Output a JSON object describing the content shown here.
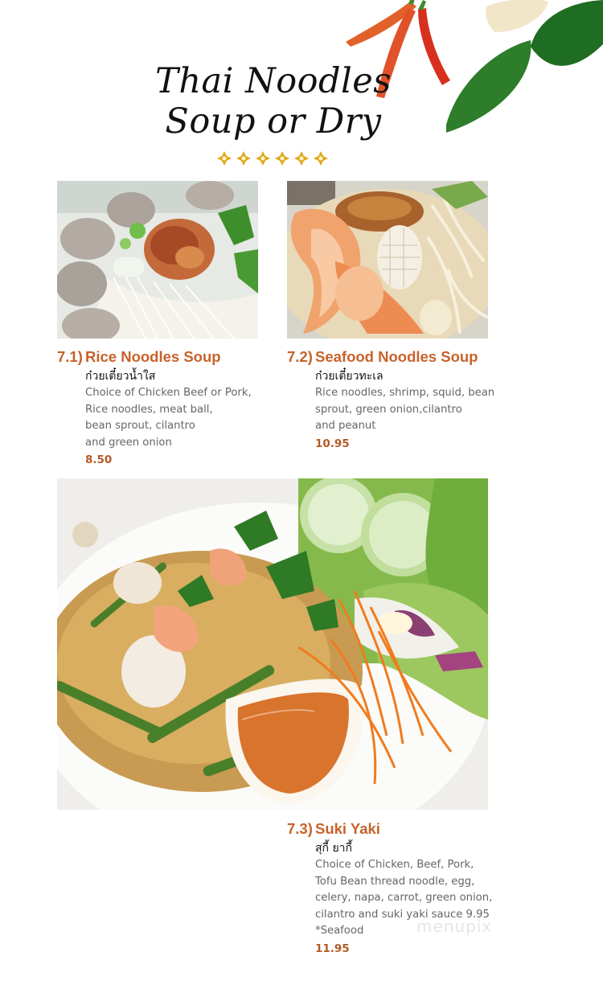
{
  "header": {
    "title_line1": "Thai Noodles",
    "title_line2": "Soup or Dry"
  },
  "colors": {
    "accent": "#c8622a",
    "price": "#b35a25",
    "ornament": "#e0a91c"
  },
  "items": [
    {
      "number": "7.1)",
      "name": "Rice Noodles Soup",
      "thai": "ก๋วยเตี๋ยวน้ำใส",
      "desc": [
        "Choice of Chicken Beef or Pork,",
        "Rice noodles, meat ball,",
        "bean sprout, cilantro",
        "and green onion"
      ],
      "price": "8.50"
    },
    {
      "number": "7.2)",
      "name": "Seafood Noodles Soup",
      "thai": "ก๋วยเตี๋ยวทะเล",
      "desc": [
        "Rice noodles, shrimp, squid, bean",
        "sprout, green onion,cilantro",
        "and peanut"
      ],
      "price": "10.95"
    },
    {
      "number": "7.3)",
      "name": "Suki Yaki",
      "thai": "สุกี้ ยากี้",
      "desc": [
        "Choice of Chicken, Beef, Pork,",
        "Tofu Bean thread noodle, egg,",
        "celery, napa, carrot, green onion,",
        "cilantro and suki yaki sauce 9.95",
        "*Seafood"
      ],
      "price": "11.95"
    }
  ],
  "watermark": "menupix"
}
